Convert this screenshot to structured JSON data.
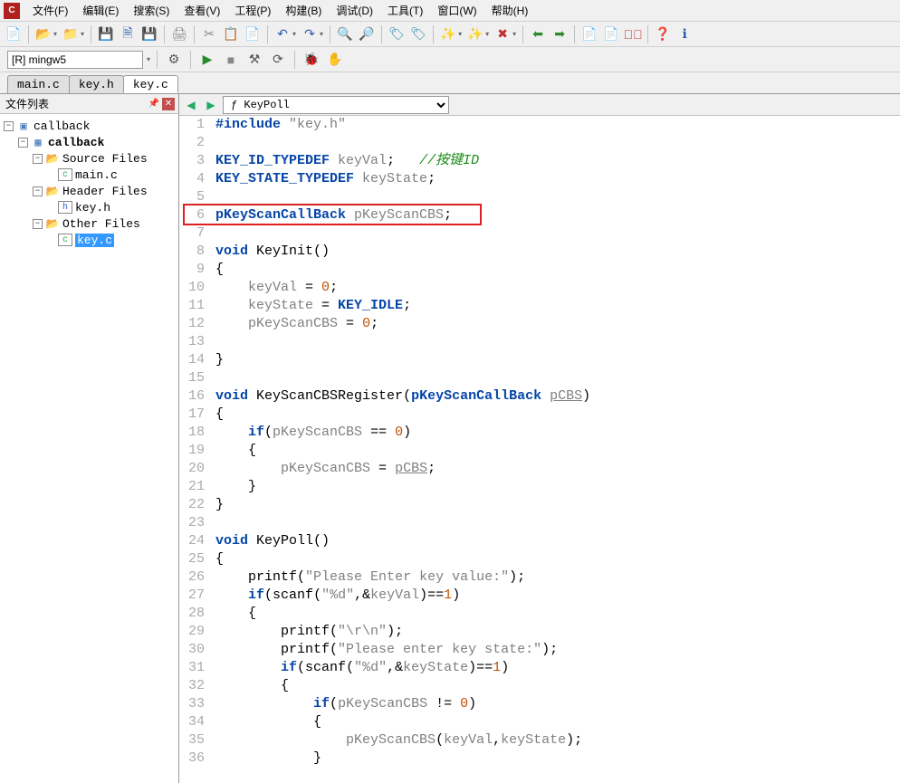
{
  "menus": {
    "file": "文件(F)",
    "edit": "编辑(E)",
    "search": "搜索(S)",
    "view": "查看(V)",
    "project": "工程(P)",
    "build": "构建(B)",
    "debug": "调试(D)",
    "tools": "工具(T)",
    "window": "窗口(W)",
    "help": "帮助(H)"
  },
  "target": "[R] mingw5",
  "global_tabs": [
    "main.c",
    "key.h",
    "key.c"
  ],
  "active_global_tab": 2,
  "panel_title": "文件列表",
  "tree": {
    "root": "callback",
    "project": "callback",
    "groups": [
      {
        "name": "Source Files",
        "files": [
          "main.c"
        ]
      },
      {
        "name": "Header Files",
        "files": [
          "key.h"
        ]
      },
      {
        "name": "Other Files",
        "files": [
          "key.c"
        ]
      }
    ],
    "selected": "key.c"
  },
  "symbol_selector": "KeyPoll",
  "code_lines": [
    {
      "n": 1,
      "tokens": [
        [
          "kw",
          "#include"
        ],
        [
          "",
          " "
        ],
        [
          "str",
          "\"key.h\""
        ]
      ]
    },
    {
      "n": 2,
      "tokens": []
    },
    {
      "n": 3,
      "tokens": [
        [
          "type",
          "KEY_ID_TYPEDEF"
        ],
        [
          "",
          " "
        ],
        [
          "ident",
          "keyVal"
        ],
        [
          "",
          ";   "
        ],
        [
          "cmt",
          "//按键ID"
        ]
      ]
    },
    {
      "n": 4,
      "tokens": [
        [
          "type",
          "KEY_STATE_TYPEDEF"
        ],
        [
          "",
          " "
        ],
        [
          "ident",
          "keyState"
        ],
        [
          "",
          ";"
        ]
      ]
    },
    {
      "n": 5,
      "tokens": []
    },
    {
      "n": 6,
      "tokens": [
        [
          "type",
          "pKeyScanCallBack"
        ],
        [
          "",
          " "
        ],
        [
          "ident",
          "pKeyScanCBS"
        ],
        [
          "",
          ";"
        ]
      ],
      "boxed": true
    },
    {
      "n": 7,
      "tokens": []
    },
    {
      "n": 8,
      "tokens": [
        [
          "kw",
          "void"
        ],
        [
          "",
          " "
        ],
        [
          "",
          "KeyInit"
        ],
        [
          "",
          "()"
        ]
      ]
    },
    {
      "n": 9,
      "tokens": [
        [
          "",
          "{"
        ]
      ]
    },
    {
      "n": 10,
      "tokens": [
        [
          "",
          "    "
        ],
        [
          "ident",
          "keyVal"
        ],
        [
          "",
          " = "
        ],
        [
          "num",
          "0"
        ],
        [
          "",
          ";"
        ]
      ]
    },
    {
      "n": 11,
      "tokens": [
        [
          "",
          "    "
        ],
        [
          "ident",
          "keyState"
        ],
        [
          "",
          " = "
        ],
        [
          "type",
          "KEY_IDLE"
        ],
        [
          "",
          ";"
        ]
      ]
    },
    {
      "n": 12,
      "tokens": [
        [
          "",
          "    "
        ],
        [
          "ident",
          "pKeyScanCBS"
        ],
        [
          "",
          " = "
        ],
        [
          "num",
          "0"
        ],
        [
          "",
          ";"
        ]
      ]
    },
    {
      "n": 13,
      "tokens": []
    },
    {
      "n": 14,
      "tokens": [
        [
          "",
          "}"
        ]
      ]
    },
    {
      "n": 15,
      "tokens": []
    },
    {
      "n": 16,
      "tokens": [
        [
          "kw",
          "void"
        ],
        [
          "",
          " "
        ],
        [
          "",
          "KeyScanCBSRegister"
        ],
        [
          "",
          "("
        ],
        [
          "type",
          "pKeyScanCallBack"
        ],
        [
          "",
          " "
        ],
        [
          "ident underlined",
          "pCBS"
        ],
        [
          "",
          ")"
        ]
      ]
    },
    {
      "n": 17,
      "tokens": [
        [
          "",
          "{"
        ]
      ]
    },
    {
      "n": 18,
      "tokens": [
        [
          "",
          "    "
        ],
        [
          "kw",
          "if"
        ],
        [
          "",
          "("
        ],
        [
          "ident",
          "pKeyScanCBS"
        ],
        [
          "",
          " == "
        ],
        [
          "num",
          "0"
        ],
        [
          "",
          ")"
        ]
      ]
    },
    {
      "n": 19,
      "tokens": [
        [
          "",
          "    {"
        ]
      ]
    },
    {
      "n": 20,
      "tokens": [
        [
          "",
          "        "
        ],
        [
          "ident",
          "pKeyScanCBS"
        ],
        [
          "",
          " = "
        ],
        [
          "ident underlined",
          "pCBS"
        ],
        [
          "",
          ";"
        ]
      ]
    },
    {
      "n": 21,
      "tokens": [
        [
          "",
          "    }"
        ]
      ]
    },
    {
      "n": 22,
      "tokens": [
        [
          "",
          "}"
        ]
      ]
    },
    {
      "n": 23,
      "tokens": []
    },
    {
      "n": 24,
      "tokens": [
        [
          "kw",
          "void"
        ],
        [
          "",
          " "
        ],
        [
          "",
          "KeyPoll"
        ],
        [
          "",
          "()"
        ]
      ]
    },
    {
      "n": 25,
      "tokens": [
        [
          "",
          "{"
        ]
      ]
    },
    {
      "n": 26,
      "tokens": [
        [
          "",
          "    "
        ],
        [
          "",
          "printf"
        ],
        [
          "",
          "("
        ],
        [
          "str",
          "\"Please Enter key value:\""
        ],
        [
          "",
          ")"
        ],
        [
          "",
          ";"
        ]
      ]
    },
    {
      "n": 27,
      "tokens": [
        [
          "",
          "    "
        ],
        [
          "kw",
          "if"
        ],
        [
          "",
          "("
        ],
        [
          "",
          "scanf"
        ],
        [
          "",
          "("
        ],
        [
          "str",
          "\"%d\""
        ],
        [
          "",
          ","
        ],
        [
          "",
          "&"
        ],
        [
          "ident",
          "keyVal"
        ],
        [
          "",
          ")"
        ],
        [
          "",
          "=="
        ],
        [
          "num",
          "1"
        ],
        [
          "",
          ")"
        ]
      ]
    },
    {
      "n": 28,
      "tokens": [
        [
          "",
          "    {"
        ]
      ]
    },
    {
      "n": 29,
      "tokens": [
        [
          "",
          "        "
        ],
        [
          "",
          "printf"
        ],
        [
          "",
          "("
        ],
        [
          "str",
          "\"\\r\\n\""
        ],
        [
          "",
          ")"
        ],
        [
          "",
          ";"
        ]
      ]
    },
    {
      "n": 30,
      "tokens": [
        [
          "",
          "        "
        ],
        [
          "",
          "printf"
        ],
        [
          "",
          "("
        ],
        [
          "str",
          "\"Please enter key state:\""
        ],
        [
          "",
          ")"
        ],
        [
          "",
          ";"
        ]
      ]
    },
    {
      "n": 31,
      "tokens": [
        [
          "",
          "        "
        ],
        [
          "kw",
          "if"
        ],
        [
          "",
          "("
        ],
        [
          "",
          "scanf"
        ],
        [
          "",
          "("
        ],
        [
          "str",
          "\"%d\""
        ],
        [
          "",
          ","
        ],
        [
          "",
          "&"
        ],
        [
          "ident",
          "keyState"
        ],
        [
          "",
          ")"
        ],
        [
          "",
          "=="
        ],
        [
          "num",
          "1"
        ],
        [
          "",
          ")"
        ]
      ]
    },
    {
      "n": 32,
      "tokens": [
        [
          "",
          "        {"
        ]
      ]
    },
    {
      "n": 33,
      "tokens": [
        [
          "",
          "            "
        ],
        [
          "kw",
          "if"
        ],
        [
          "",
          "("
        ],
        [
          "ident",
          "pKeyScanCBS"
        ],
        [
          "",
          " != "
        ],
        [
          "num",
          "0"
        ],
        [
          "",
          ")"
        ]
      ]
    },
    {
      "n": 34,
      "tokens": [
        [
          "",
          "            {"
        ]
      ]
    },
    {
      "n": 35,
      "tokens": [
        [
          "",
          "                "
        ],
        [
          "ident",
          "pKeyScanCBS"
        ],
        [
          "",
          "("
        ],
        [
          "ident",
          "keyVal"
        ],
        [
          "",
          ","
        ],
        [
          "ident",
          "keyState"
        ],
        [
          "",
          ")"
        ],
        [
          "",
          ";"
        ]
      ]
    },
    {
      "n": 36,
      "tokens": [
        [
          "",
          "            }"
        ]
      ]
    }
  ]
}
